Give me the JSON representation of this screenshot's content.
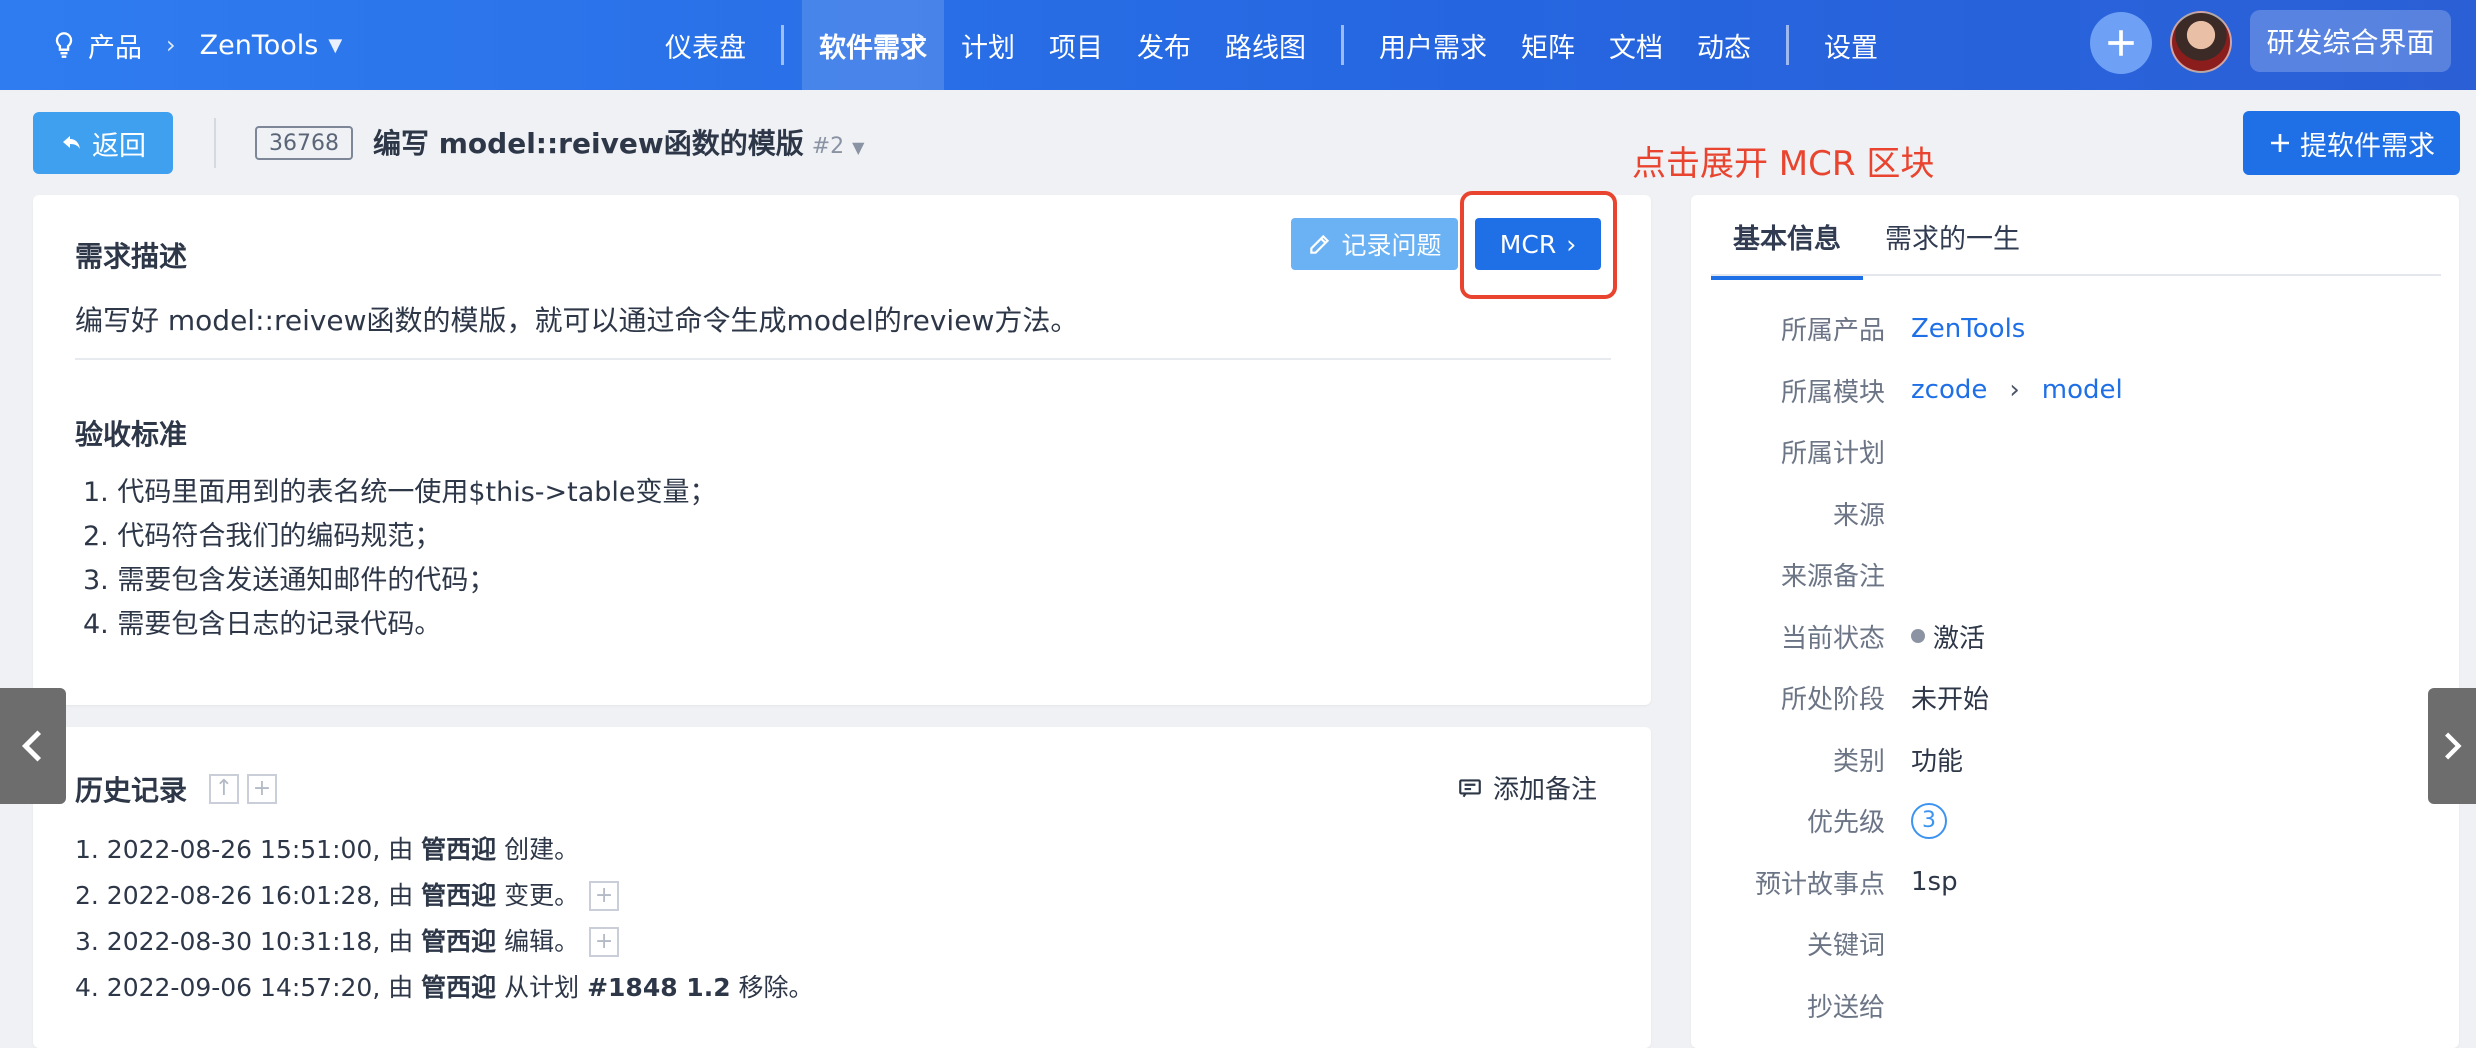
{
  "header": {
    "product_label": "产品",
    "product_name": "ZenTools",
    "nav": [
      "仪表盘",
      "软件需求",
      "计划",
      "项目",
      "发布",
      "路线图",
      "用户需求",
      "矩阵",
      "文档",
      "动态",
      "设置"
    ],
    "active_nav": "软件需求",
    "workspace_button": "研发综合界面"
  },
  "toolbar": {
    "back_label": "返回",
    "story_id": "36768",
    "story_title": "编写 model::reivew函数的模版",
    "story_version": "#2",
    "annotation": "点击展开 MCR 区块",
    "create_label": "提软件需求"
  },
  "description": {
    "title": "需求描述",
    "text": "编写好 model::reivew函数的模版，就可以通过命令生成model的review方法。",
    "log_button": "记录问题",
    "mcr_button": "MCR",
    "criteria_title": "验收标准",
    "criteria": [
      "1. 代码里面用到的表名统一使用$this->table变量；",
      "2. 代码符合我们的编码规范；",
      "3. 需要包含发送通知邮件的代码；",
      "4. 需要包含日志的记录代码。"
    ]
  },
  "history": {
    "title": "历史记录",
    "add_note": "添加备注",
    "entries": [
      {
        "pre": "1. 2022-08-26 15:51:00, 由 ",
        "user": "管西迎",
        "post": " 创建。",
        "extra": ""
      },
      {
        "pre": "2. 2022-08-26 16:01:28, 由 ",
        "user": "管西迎",
        "post": " 变更。",
        "extra": ""
      },
      {
        "pre": "3. 2022-08-30 10:31:18, 由 ",
        "user": "管西迎",
        "post": " 编辑。",
        "extra": ""
      },
      {
        "pre": "4. 2022-09-06 14:57:20, 由 ",
        "user": "管西迎",
        "post": " 从计划 ",
        "extra": "#1848 1.2",
        "tail": " 移除。"
      }
    ]
  },
  "side": {
    "tabs": [
      "基本信息",
      "需求的一生"
    ],
    "props": {
      "product": {
        "key": "所属产品",
        "value": "ZenTools"
      },
      "module": {
        "key": "所属模块",
        "value1": "zcode",
        "value2": "model"
      },
      "plan": {
        "key": "所属计划",
        "value": ""
      },
      "source": {
        "key": "来源",
        "value": ""
      },
      "source_note": {
        "key": "来源备注",
        "value": ""
      },
      "status": {
        "key": "当前状态",
        "value": "激活"
      },
      "stage": {
        "key": "所处阶段",
        "value": "未开始"
      },
      "category": {
        "key": "类别",
        "value": "功能"
      },
      "priority": {
        "key": "优先级",
        "value": "3"
      },
      "estimate": {
        "key": "预计故事点",
        "value": "1sp"
      },
      "keywords": {
        "key": "关键词",
        "value": ""
      },
      "cc": {
        "key": "抄送给",
        "value": ""
      }
    }
  },
  "colors": {
    "primary": "#1f6fe6",
    "topbar": "#2566e0",
    "annotation": "#e8442f",
    "link": "#1f6fe6"
  },
  "icons": {
    "product": "lightbulb-icon",
    "back": "undo-arrow-icon",
    "create": "plus-icon",
    "log": "pencil-icon",
    "mcr": "chevron-right-icon",
    "add_note": "comment-icon"
  }
}
